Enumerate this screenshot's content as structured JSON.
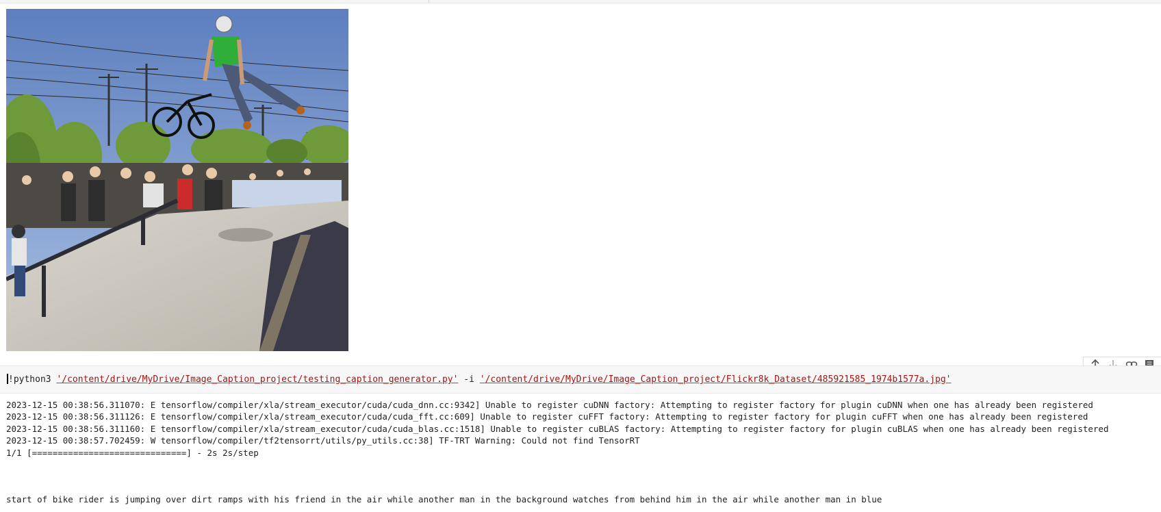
{
  "output_image": {
    "description_icon": "bmx-skatepark-photo"
  },
  "cell_toolbar": {
    "icons": [
      "arrow-up-icon",
      "arrow-down-icon",
      "link-icon",
      "comment-icon"
    ]
  },
  "code_cell": {
    "command": "!python3",
    "script_path": "'/content/drive/MyDrive/Image_Caption_project/testing_caption_generator.py'",
    "flag": "-i",
    "image_path": "'/content/drive/MyDrive/Image_Caption_project/Flickr8k_Dataset/485921585_1974b1577a.jpg'"
  },
  "output": {
    "log_lines": [
      "2023-12-15 00:38:56.311070: E tensorflow/compiler/xla/stream_executor/cuda/cuda_dnn.cc:9342] Unable to register cuDNN factory: Attempting to register factory for plugin cuDNN when one has already been registered",
      "2023-12-15 00:38:56.311126: E tensorflow/compiler/xla/stream_executor/cuda/cuda_fft.cc:609] Unable to register cuFFT factory: Attempting to register factory for plugin cuFFT when one has already been registered",
      "2023-12-15 00:38:56.311160: E tensorflow/compiler/xla/stream_executor/cuda/cuda_blas.cc:1518] Unable to register cuBLAS factory: Attempting to register factory for plugin cuBLAS when one has already been registered",
      "2023-12-15 00:38:57.702459: W tensorflow/compiler/tf2tensorrt/utils/py_utils.cc:38] TF-TRT Warning: Could not find TensorRT",
      "1/1 [==============================] - 2s 2s/step"
    ],
    "caption": "start of bike rider is jumping over dirt ramps with his friend in the air while another man in the background watches from behind him in the air while another man in blue"
  },
  "colors": {
    "string": "#a31515",
    "cell_background": "#f7f7f7",
    "sky": "#6f8fc4"
  }
}
